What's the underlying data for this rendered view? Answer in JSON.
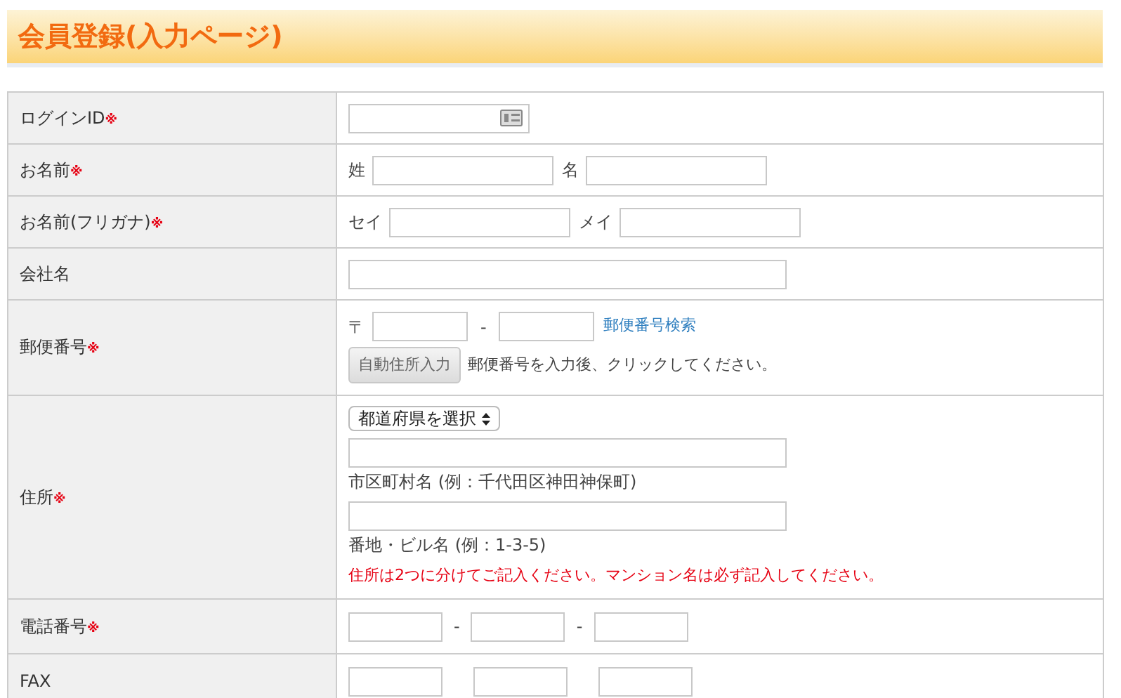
{
  "title": "会員登録(入力ページ)",
  "rows": [
    {
      "kind": "id",
      "label": "ログインID",
      "required_mark": "※"
    },
    {
      "kind": "pair",
      "label": "お名前",
      "required_mark": "※",
      "parts": [
        "姓",
        "名"
      ]
    },
    {
      "kind": "pair",
      "label": "お名前(フリガナ)",
      "required_mark": "※",
      "parts": [
        "セイ",
        "メイ"
      ]
    },
    {
      "kind": "single",
      "label": "会社名"
    },
    {
      "kind": "postal",
      "label": "郵便番号",
      "required_mark": "※",
      "prefix": "〒",
      "separator": "-",
      "link": "郵便番号検索",
      "button": "自動住所入力",
      "hint": "郵便番号を入力後、クリックしてください。"
    },
    {
      "kind": "address",
      "label": "住所",
      "required_mark": "※",
      "select": "都道府県を選択",
      "captions": [
        "市区町村名 (例：千代田区神田神保町)",
        "番地・ビル名 (例：1-3-5)"
      ],
      "note": "住所は2つに分けてご記入ください。マンション名は必ず記入してください。"
    },
    {
      "kind": "triple",
      "label": "電話番号",
      "required_mark": "※",
      "separators": [
        "-",
        "-"
      ]
    },
    {
      "kind": "triple",
      "label": "FAX"
    }
  ]
}
